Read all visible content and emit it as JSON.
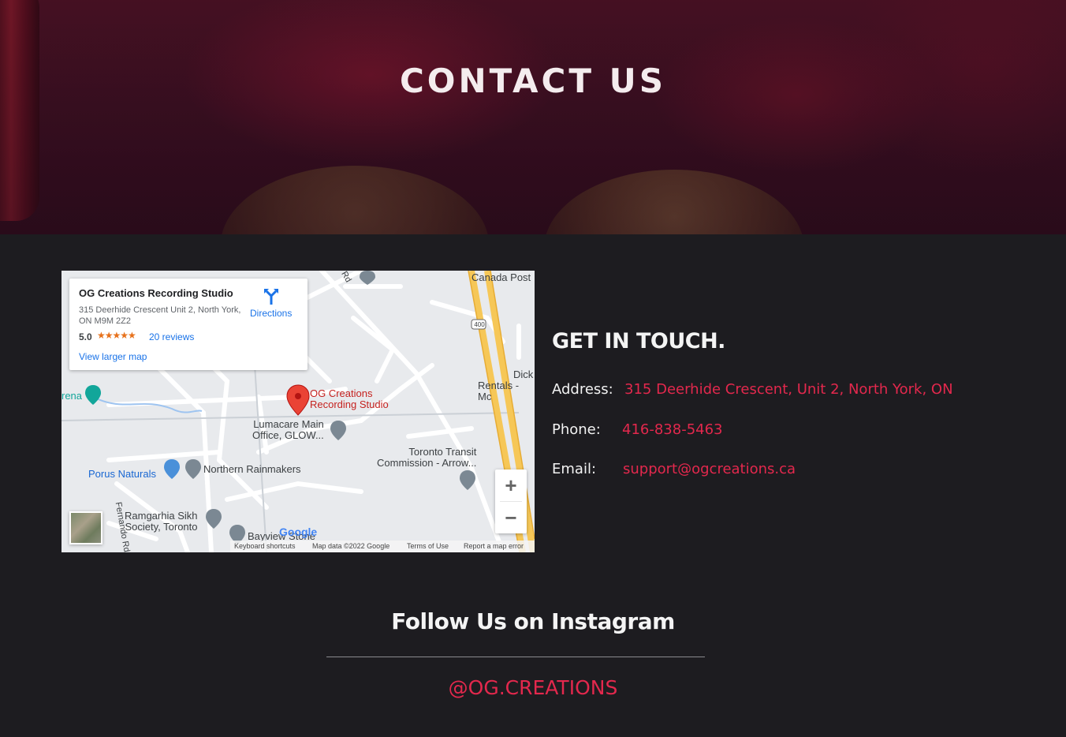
{
  "hero": {
    "title": "CONTACT US"
  },
  "map": {
    "card": {
      "title": "OG Creations Recording Studio",
      "address": "315 Deerhide Crescent Unit 2, North York, ON M9M 2Z2",
      "rating": "5.0",
      "stars": "★★★★★",
      "reviews": "20 reviews",
      "larger_map": "View larger map",
      "directions": "Directions"
    },
    "places": {
      "pin_name": "OG Creations\nRecording Studio",
      "canada_post": "Canada Post",
      "dick": "Dick",
      "rentals": "Rentals - Mc",
      "arena": "rena",
      "lumacare": "Lumacare Main\nOffice, GLOW...",
      "ttc": "Toronto Transit\nCommission - Arrow...",
      "porus": "Porus Naturals",
      "northern": "Northern Rainmakers",
      "ramgarhia": "Ramgarhia Sikh\nSociety, Toronto",
      "bayview": "Bayview Stone",
      "fernando": "Fernando Rd",
      "rd": "Rd",
      "hwy": "400"
    },
    "zoom_in": "+",
    "zoom_out": "−",
    "google": "Google",
    "footer": {
      "shortcuts": "Keyboard shortcuts",
      "mapdata": "Map data ©2022 Google",
      "terms": "Terms of Use",
      "report": "Report a map error"
    }
  },
  "touch": {
    "heading": "GET IN TOUCH.",
    "address_label": "Address:",
    "address_value": "315 Deerhide Crescent, Unit 2, North York, ON",
    "phone_label": "Phone:",
    "phone_value": "416-838-5463",
    "email_label": "Email:",
    "email_value": "support@ogcreations.ca"
  },
  "instagram": {
    "heading": "Follow Us on Instagram",
    "handle": "@OG.CREATIONS"
  },
  "colors": {
    "accent": "#e3284d",
    "background": "#1d1c20"
  }
}
